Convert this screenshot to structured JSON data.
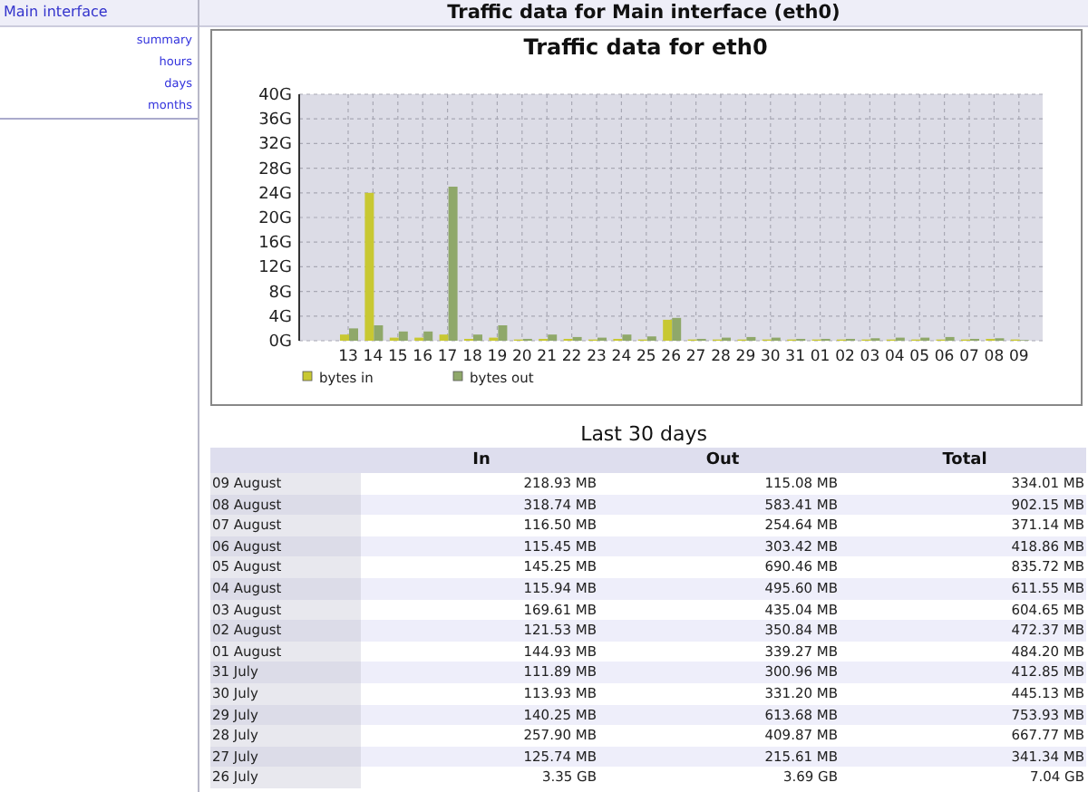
{
  "sidebar": {
    "title": "Main interface",
    "items": [
      {
        "label": "summary"
      },
      {
        "label": "hours"
      },
      {
        "label": "days"
      },
      {
        "label": "months"
      }
    ]
  },
  "header": {
    "title": "Traffic data for Main interface (eth0)"
  },
  "chart": {
    "chart_data": {
      "type": "bar",
      "title": "Traffic data for eth0",
      "categories": [
        "13",
        "14",
        "15",
        "16",
        "17",
        "18",
        "19",
        "20",
        "21",
        "22",
        "23",
        "24",
        "25",
        "26",
        "27",
        "28",
        "29",
        "30",
        "31",
        "01",
        "02",
        "03",
        "04",
        "05",
        "06",
        "07",
        "08",
        "09"
      ],
      "series": [
        {
          "name": "bytes in",
          "color": "#c8c832",
          "values": [
            1,
            24,
            0.5,
            0.5,
            1,
            0.3,
            0.5,
            0.2,
            0.3,
            0.3,
            0.2,
            0.3,
            0.2,
            3.4,
            0.2,
            0.2,
            0.2,
            0.2,
            0.2,
            0.2,
            0.2,
            0.2,
            0.2,
            0.2,
            0.2,
            0.2,
            0.3,
            0.2
          ]
        },
        {
          "name": "bytes out",
          "color": "#8fa86a",
          "values": [
            2,
            2.5,
            1.5,
            1.5,
            25,
            1,
            2.5,
            0.3,
            1,
            0.6,
            0.5,
            1,
            0.7,
            3.7,
            0.3,
            0.5,
            0.6,
            0.5,
            0.3,
            0.3,
            0.3,
            0.4,
            0.5,
            0.5,
            0.6,
            0.3,
            0.4,
            0.1
          ]
        }
      ],
      "ylim": [
        0,
        40
      ],
      "grid": true,
      "legend": "bottom",
      "yticks": [
        {
          "value": 0,
          "label": "0G"
        },
        {
          "value": 4,
          "label": "4G"
        },
        {
          "value": 8,
          "label": "8G"
        },
        {
          "value": 12,
          "label": "12G"
        },
        {
          "value": 16,
          "label": "16G"
        },
        {
          "value": 20,
          "label": "20G"
        },
        {
          "value": 24,
          "label": "24G"
        },
        {
          "value": 28,
          "label": "28G"
        },
        {
          "value": 32,
          "label": "32G"
        },
        {
          "value": 36,
          "label": "36G"
        },
        {
          "value": 40,
          "label": "40G"
        }
      ]
    }
  },
  "table": {
    "title": "Last 30 days",
    "columns": [
      "In",
      "Out",
      "Total"
    ],
    "rows": [
      {
        "date": "09 August",
        "in": "218.93 MB",
        "out": "115.08 MB",
        "total": "334.01 MB"
      },
      {
        "date": "08 August",
        "in": "318.74 MB",
        "out": "583.41 MB",
        "total": "902.15 MB"
      },
      {
        "date": "07 August",
        "in": "116.50 MB",
        "out": "254.64 MB",
        "total": "371.14 MB"
      },
      {
        "date": "06 August",
        "in": "115.45 MB",
        "out": "303.42 MB",
        "total": "418.86 MB"
      },
      {
        "date": "05 August",
        "in": "145.25 MB",
        "out": "690.46 MB",
        "total": "835.72 MB"
      },
      {
        "date": "04 August",
        "in": "115.94 MB",
        "out": "495.60 MB",
        "total": "611.55 MB"
      },
      {
        "date": "03 August",
        "in": "169.61 MB",
        "out": "435.04 MB",
        "total": "604.65 MB"
      },
      {
        "date": "02 August",
        "in": "121.53 MB",
        "out": "350.84 MB",
        "total": "472.37 MB"
      },
      {
        "date": "01 August",
        "in": "144.93 MB",
        "out": "339.27 MB",
        "total": "484.20 MB"
      },
      {
        "date": "31 July",
        "in": "111.89 MB",
        "out": "300.96 MB",
        "total": "412.85 MB"
      },
      {
        "date": "30 July",
        "in": "113.93 MB",
        "out": "331.20 MB",
        "total": "445.13 MB"
      },
      {
        "date": "29 July",
        "in": "140.25 MB",
        "out": "613.68 MB",
        "total": "753.93 MB"
      },
      {
        "date": "28 July",
        "in": "257.90 MB",
        "out": "409.87 MB",
        "total": "667.77 MB"
      },
      {
        "date": "27 July",
        "in": "125.74 MB",
        "out": "215.61 MB",
        "total": "341.34 MB"
      },
      {
        "date": "26 July",
        "in": "3.35 GB",
        "out": "3.69 GB",
        "total": "7.04 GB"
      }
    ]
  }
}
